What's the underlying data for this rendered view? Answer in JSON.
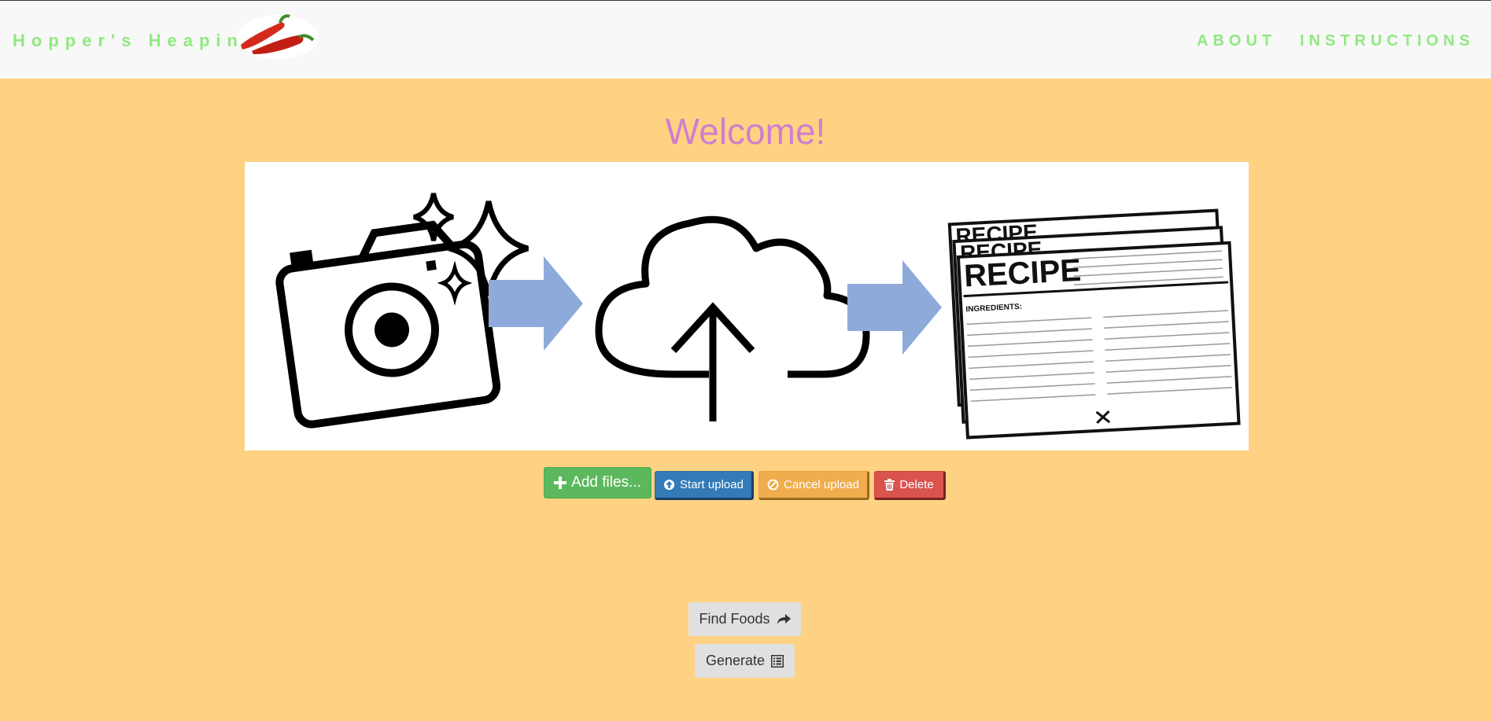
{
  "nav": {
    "brand": "Hopper's Heapin'",
    "links": [
      {
        "label": "ABOUT"
      },
      {
        "label": "INSTRUCTIONS"
      }
    ]
  },
  "main": {
    "title": "Welcome!",
    "hero_recipe_word": "RECIPE",
    "hero_ingredients_label": "INGREDIENTS:",
    "upload_buttons": {
      "add": "Add files...",
      "start": "Start upload",
      "cancel": "Cancel upload",
      "delete": "Delete"
    },
    "actions": {
      "find_foods": "Find Foods",
      "generate": "Generate"
    }
  },
  "colors": {
    "page_bg": "#fed282",
    "nav_bg": "#f8f8f8",
    "brand": "#90ea80",
    "title": "#cf7fce",
    "arrow": "#8eaadb"
  },
  "icons": {
    "logo": "chili-peppers-icon",
    "add": "plus-icon",
    "start": "circle-arrow-up-icon",
    "cancel": "ban-icon",
    "delete": "trash-icon",
    "find": "share-arrow-icon",
    "generate": "list-alt-icon"
  }
}
